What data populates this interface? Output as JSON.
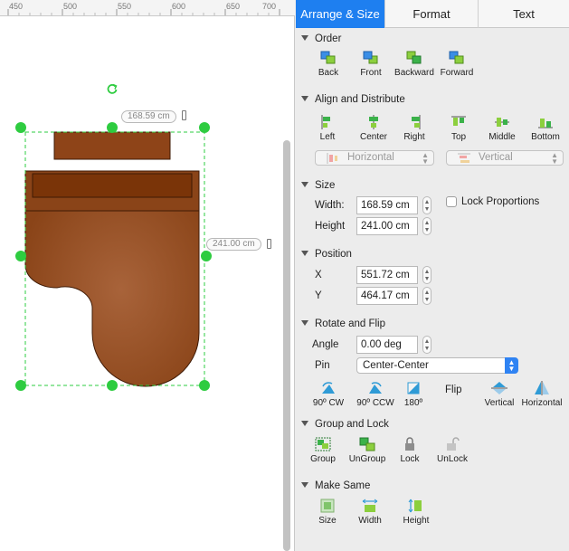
{
  "canvas": {
    "ruler_labels": [
      "450",
      "500",
      "550",
      "600",
      "650",
      "700"
    ],
    "width_badge": "168.59 cm",
    "height_badge": "241.00 cm",
    "colors": {
      "handle": "#2ecc40",
      "shape_fill": "#8b4513",
      "shape_dark": "#6b2f0a",
      "selection": "#2ecc40"
    }
  },
  "tabs": [
    {
      "label": "Arrange & Size",
      "active": true
    },
    {
      "label": "Format",
      "active": false
    },
    {
      "label": "Text",
      "active": false
    }
  ],
  "order": {
    "title": "Order",
    "buttons": [
      {
        "label": "Back",
        "icon": "back-icon"
      },
      {
        "label": "Front",
        "icon": "front-icon"
      },
      {
        "label": "Backward",
        "icon": "backward-icon"
      },
      {
        "label": "Forward",
        "icon": "forward-icon"
      }
    ]
  },
  "align": {
    "title": "Align and Distribute",
    "buttons": [
      {
        "label": "Left",
        "icon": "align-left-icon"
      },
      {
        "label": "Center",
        "icon": "align-center-icon"
      },
      {
        "label": "Right",
        "icon": "align-right-icon"
      },
      {
        "label": "Top",
        "icon": "align-top-icon"
      },
      {
        "label": "Middle",
        "icon": "align-middle-icon"
      },
      {
        "label": "Bottom",
        "icon": "align-bottom-icon"
      }
    ],
    "horizontal_label": "Horizontal",
    "vertical_label": "Vertical"
  },
  "size": {
    "title": "Size",
    "width_label": "Width:",
    "width_value": "168.59 cm",
    "height_label": "Height",
    "height_value": "241.00 cm",
    "lock_label": "Lock Proportions"
  },
  "position": {
    "title": "Position",
    "x_label": "X",
    "x_value": "551.72 cm",
    "y_label": "Y",
    "y_value": "464.17 cm"
  },
  "rotate": {
    "title": "Rotate and Flip",
    "angle_label": "Angle",
    "angle_value": "0.00 deg",
    "pin_label": "Pin",
    "pin_value": "Center-Center",
    "buttons": [
      {
        "label": "90º CW",
        "icon": "rotate-cw-icon"
      },
      {
        "label": "90º CCW",
        "icon": "rotate-ccw-icon"
      },
      {
        "label": "180º",
        "icon": "rotate-180-icon"
      }
    ],
    "flip_label": "Flip",
    "flip_buttons": [
      {
        "label": "Vertical",
        "icon": "flip-vertical-icon"
      },
      {
        "label": "Horizontal",
        "icon": "flip-horizontal-icon"
      }
    ]
  },
  "group": {
    "title": "Group and Lock",
    "buttons": [
      {
        "label": "Group",
        "icon": "group-icon"
      },
      {
        "label": "UnGroup",
        "icon": "ungroup-icon"
      },
      {
        "label": "Lock",
        "icon": "lock-icon"
      },
      {
        "label": "UnLock",
        "icon": "unlock-icon"
      }
    ]
  },
  "same": {
    "title": "Make Same",
    "buttons": [
      {
        "label": "Size",
        "icon": "same-size-icon"
      },
      {
        "label": "Width",
        "icon": "same-width-icon"
      },
      {
        "label": "Height",
        "icon": "same-height-icon"
      }
    ]
  }
}
